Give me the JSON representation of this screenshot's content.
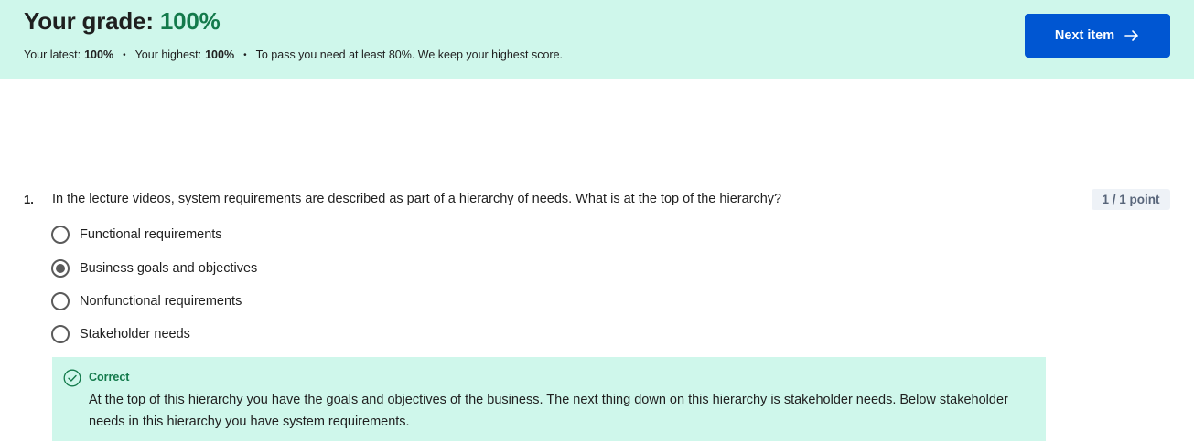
{
  "grade": {
    "title_prefix": "Your grade:",
    "percent": "100%",
    "latest_label": "Your latest:",
    "latest_value": "100%",
    "highest_label": "Your highest:",
    "highest_value": "100%",
    "bullet": "•",
    "pass_note": "To pass you need at least 80%. We keep your highest score."
  },
  "next_button": {
    "label": "Next item",
    "icon": "arrow-right-icon"
  },
  "question": {
    "number": "1.",
    "text": "In the lecture videos, system requirements are described as part of a hierarchy of needs. What is at the top of the hierarchy?",
    "points": "1 / 1 point",
    "options": [
      {
        "label": "Functional requirements",
        "selected": false
      },
      {
        "label": "Business goals and objectives",
        "selected": true
      },
      {
        "label": "Nonfunctional requirements",
        "selected": false
      },
      {
        "label": "Stakeholder needs",
        "selected": false
      }
    ],
    "feedback": {
      "icon": "check-circle-icon",
      "label": "Correct",
      "text": "At the top of this hierarchy you have the goals and objectives of the business. The next thing down on this hierarchy is stakeholder needs. Below stakeholder needs in this hierarchy you have system requirements."
    }
  },
  "colors": {
    "banner": "#cff7eb",
    "success": "#137a4b",
    "primary": "#0056d2"
  }
}
